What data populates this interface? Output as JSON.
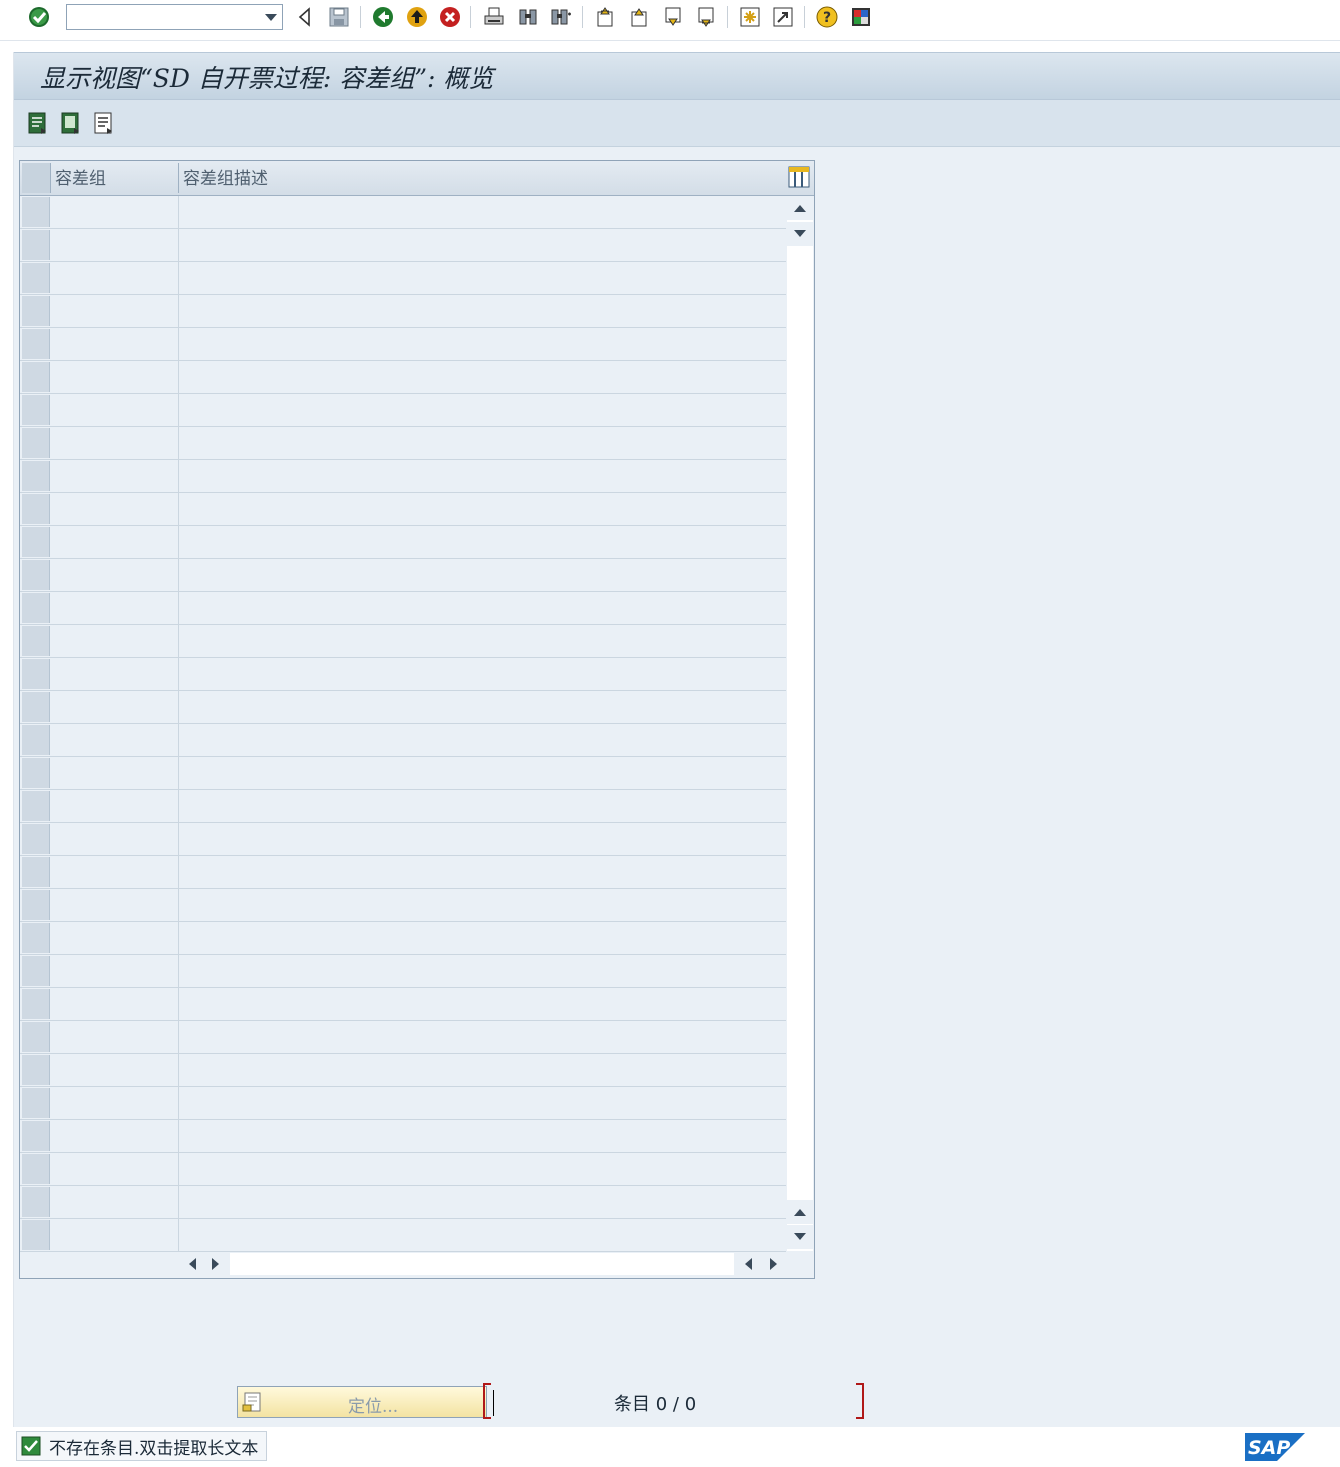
{
  "toolbar": {
    "command_value": "",
    "icons": [
      "enter-icon",
      "dropdown-icon",
      "back-arrow-icon",
      "save-icon",
      "back-icon",
      "exit-icon",
      "cancel-icon",
      "print-icon",
      "find-icon",
      "find-next-icon",
      "first-page-icon",
      "previous-page-icon",
      "next-page-icon",
      "last-page-icon",
      "new-session-icon",
      "shortcut-icon",
      "help-icon",
      "layout-menu-icon"
    ]
  },
  "header": {
    "title": "显示视图“SD 自开票过程: 容差组”: 概览"
  },
  "app_toolbar": {
    "icons": [
      "details-icon",
      "select-all-icon",
      "deselect-all-icon"
    ]
  },
  "table": {
    "columns": [
      "容差组",
      "容差组描述"
    ],
    "rows": [
      [
        "",
        ""
      ],
      [
        "",
        ""
      ],
      [
        "",
        ""
      ],
      [
        "",
        ""
      ],
      [
        "",
        ""
      ],
      [
        "",
        ""
      ],
      [
        "",
        ""
      ],
      [
        "",
        ""
      ],
      [
        "",
        ""
      ],
      [
        "",
        ""
      ],
      [
        "",
        ""
      ],
      [
        "",
        ""
      ],
      [
        "",
        ""
      ],
      [
        "",
        ""
      ],
      [
        "",
        ""
      ],
      [
        "",
        ""
      ],
      [
        "",
        ""
      ],
      [
        "",
        ""
      ],
      [
        "",
        ""
      ],
      [
        "",
        ""
      ],
      [
        "",
        ""
      ],
      [
        "",
        ""
      ],
      [
        "",
        ""
      ],
      [
        "",
        ""
      ],
      [
        "",
        ""
      ],
      [
        "",
        ""
      ],
      [
        "",
        ""
      ],
      [
        "",
        ""
      ],
      [
        "",
        ""
      ],
      [
        "",
        ""
      ],
      [
        "",
        ""
      ],
      [
        "",
        ""
      ]
    ]
  },
  "position": {
    "button_label": "定位...",
    "entry_label": "条目",
    "entry_value": "0 / 0"
  },
  "status": {
    "message": "不存在条目.双击提取长文本"
  },
  "colors": {
    "frame_bg": "#eaf0f6",
    "title_bg": "#c3d3e1",
    "position_btn": "#f3e3a2",
    "bracket": "#b01818",
    "sap_blue": "#1a6fc4"
  }
}
